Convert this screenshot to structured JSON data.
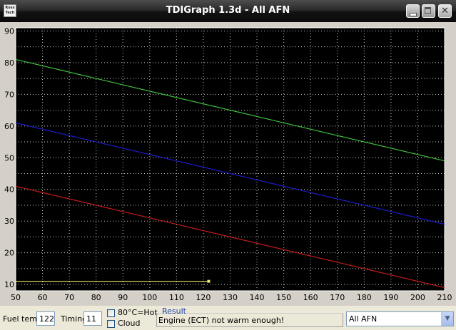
{
  "window": {
    "title": "TDIGraph 1.3d - All AFN",
    "icon_text": "Ross Tech",
    "icon": "ross-tech-logo-icon",
    "controls": [
      "minimize-icon",
      "maximize-icon",
      "close-icon"
    ],
    "close_glyph": "✕"
  },
  "chart_data": {
    "type": "line",
    "background": "#000000",
    "grid": true,
    "grid_color": "#c8c8c8",
    "xlim": [
      50,
      210
    ],
    "ylim": [
      8,
      91
    ],
    "x_ticks": [
      50,
      60,
      70,
      80,
      90,
      100,
      110,
      120,
      130,
      140,
      150,
      160,
      170,
      180,
      190,
      200,
      210
    ],
    "y_ticks": [
      10,
      20,
      30,
      40,
      50,
      60,
      70,
      80,
      90
    ],
    "series": [
      {
        "color": "#3ec03e",
        "x": [
          50,
          210
        ],
        "y": [
          81,
          49
        ]
      },
      {
        "color": "#1c1cc8",
        "x": [
          50,
          210
        ],
        "y": [
          61,
          29
        ]
      },
      {
        "color": "#c81c1c",
        "x": [
          50,
          210
        ],
        "y": [
          41,
          9
        ]
      },
      {
        "color": "#e8e870",
        "x": [
          50,
          122
        ],
        "y": [
          11,
          11
        ],
        "marker_end": true
      }
    ]
  },
  "controls": {
    "fuel_temp_label": "Fuel temp",
    "fuel_temp_value": "122",
    "timing_label": "Timing",
    "timing_value": "11",
    "hot_checkbox_label": "80°C=Hot",
    "hot_checked": false,
    "cloud_checkbox_label": "Cloud",
    "cloud_checked": false,
    "result_label": "Result",
    "result_text": "Engine (ECT) not warm enough!",
    "profile_select_value": "All AFN",
    "select_arrow": "▼"
  }
}
